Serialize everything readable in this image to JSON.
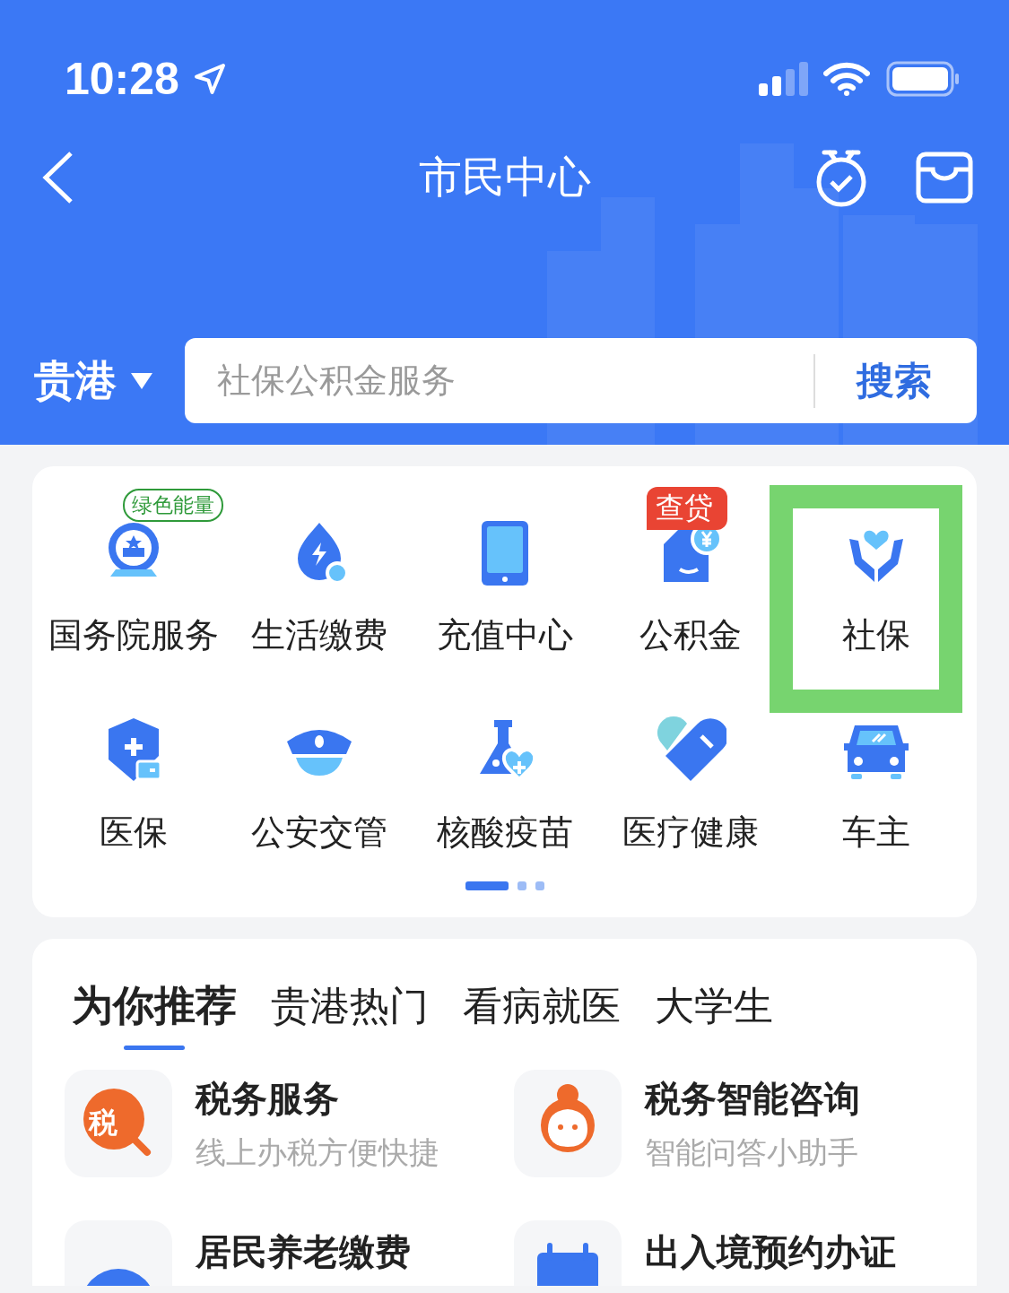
{
  "status_bar": {
    "time": "10:28"
  },
  "nav": {
    "title": "市民中心"
  },
  "search": {
    "city": "贵港",
    "placeholder": "社保公积金服务",
    "button": "搜索"
  },
  "services": [
    {
      "label": "国务院服务",
      "badge": {
        "text": "绿色能量",
        "kind": "outline"
      },
      "highlighted": false
    },
    {
      "label": "生活缴费",
      "highlighted": false
    },
    {
      "label": "充值中心",
      "highlighted": false
    },
    {
      "label": "公积金",
      "badge": {
        "text": "查贷",
        "kind": "filled"
      },
      "highlighted": false
    },
    {
      "label": "社保",
      "highlighted": true
    },
    {
      "label": "医保",
      "highlighted": false
    },
    {
      "label": "公安交管",
      "highlighted": false
    },
    {
      "label": "核酸疫苗",
      "highlighted": false
    },
    {
      "label": "医疗健康",
      "highlighted": false
    },
    {
      "label": "车主",
      "highlighted": false
    }
  ],
  "pages": [
    {
      "selected": true
    },
    {
      "selected": false
    },
    {
      "selected": false
    }
  ],
  "tabs": [
    {
      "label": "为你推荐",
      "selected": true
    },
    {
      "label": "贵港热门",
      "selected": false
    },
    {
      "label": "看病就医",
      "selected": false
    },
    {
      "label": "大学生",
      "selected": false
    }
  ],
  "recommendations": [
    {
      "title": "税务服务",
      "subtitle": "线上办税方便快捷",
      "icon_text": "税"
    },
    {
      "title": "税务智能咨询",
      "subtitle": "智能问答小助手"
    },
    {
      "title": "居民养老缴费"
    },
    {
      "title": "出入境预约办证"
    }
  ]
}
